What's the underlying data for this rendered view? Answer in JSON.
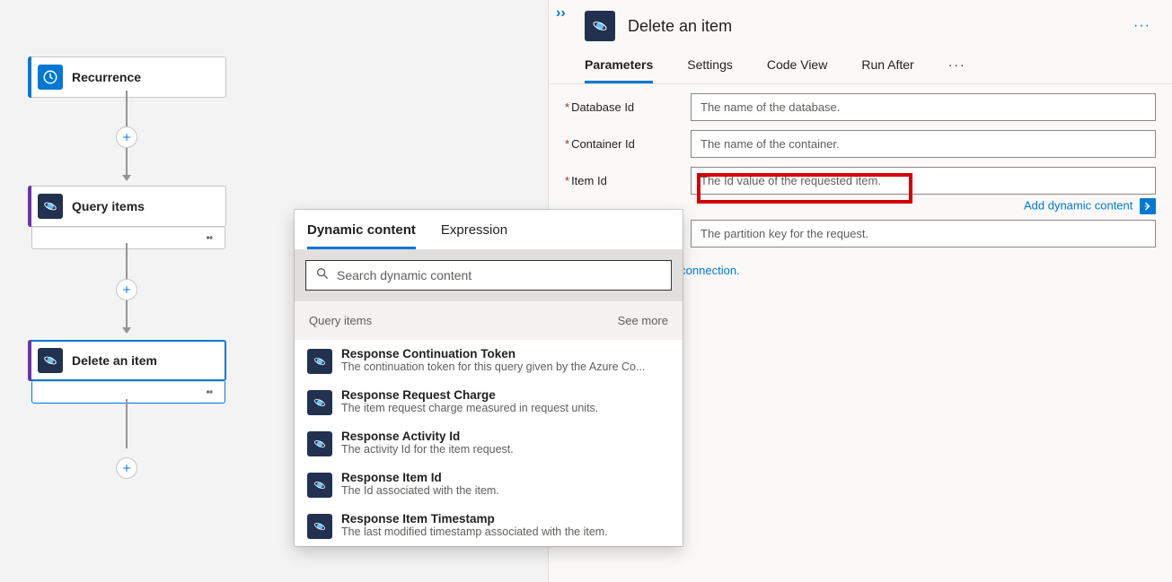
{
  "canvas": {
    "nodes": [
      {
        "label": "Recurrence"
      },
      {
        "label": "Query items"
      },
      {
        "label": "Delete an item"
      }
    ]
  },
  "panel": {
    "title": "Delete an item",
    "tabs": {
      "parameters": "Parameters",
      "settings": "Settings",
      "codeview": "Code View",
      "runafter": "Run After"
    },
    "fields": {
      "database": {
        "label": "Database Id",
        "placeholder": "The name of the database."
      },
      "container": {
        "label": "Container Id",
        "placeholder": "The name of the container."
      },
      "item": {
        "label": "Item Id",
        "placeholder": "The Id value of the requested item."
      },
      "partition": {
        "placeholder": "The partition key for the request."
      }
    },
    "add_dynamic_link": "Add dynamic content",
    "connection_text": "Connection.",
    "change_connection": "Change connection."
  },
  "popup": {
    "tabs": {
      "dynamic": "Dynamic content",
      "expression": "Expression"
    },
    "search_placeholder": "Search dynamic content",
    "group_label": "Query items",
    "see_more": "See more",
    "items": [
      {
        "title": "Response Continuation Token",
        "desc": "The continuation token for this query given by the Azure Co..."
      },
      {
        "title": "Response Request Charge",
        "desc": "The item request charge measured in request units."
      },
      {
        "title": "Response Activity Id",
        "desc": "The activity Id for the item request."
      },
      {
        "title": "Response Item Id",
        "desc": "The Id associated with the item."
      },
      {
        "title": "Response Item Timestamp",
        "desc": "The last modified timestamp associated with the item."
      }
    ]
  }
}
